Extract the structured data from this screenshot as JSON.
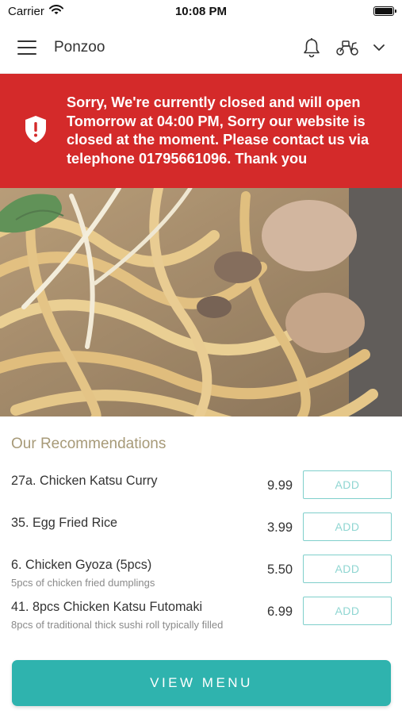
{
  "status_bar": {
    "carrier": "Carrier",
    "time": "10:08 PM",
    "icons": [
      "wifi-icon",
      "battery-icon"
    ]
  },
  "header": {
    "title": "Ponzoo",
    "icons": [
      "menu-icon",
      "bell-icon",
      "scooter-icon",
      "chevron-down-icon"
    ]
  },
  "banner": {
    "text": "Sorry, We're currently closed and will open Tomorrow at 04:00 PM, Sorry our website is closed at the moment. Please contact us via telephone 01795661096. Thank you",
    "icon": "shield-alert-icon",
    "color": "#d42a2a"
  },
  "hero": {
    "icon": "food-photo"
  },
  "recommendations": {
    "title": "Our Recommendations",
    "items": [
      {
        "name": "27a. Chicken Katsu Curry",
        "description": "",
        "price": "9.99",
        "add_label": "ADD"
      },
      {
        "name": "35. Egg Fried Rice",
        "description": "",
        "price": "3.99",
        "add_label": "ADD"
      },
      {
        "name": "6. Chicken Gyoza (5pcs)",
        "description": "5pcs of chicken fried dumplings",
        "price": "5.50",
        "add_label": "ADD"
      },
      {
        "name": "41. 8pcs Chicken Katsu Futomaki",
        "description": "8pcs of traditional thick sushi roll typically filled",
        "price": "6.99",
        "add_label": "ADD"
      }
    ]
  },
  "footer": {
    "view_menu_label": "VIEW MENU",
    "accent_color": "#2fb3ae"
  }
}
